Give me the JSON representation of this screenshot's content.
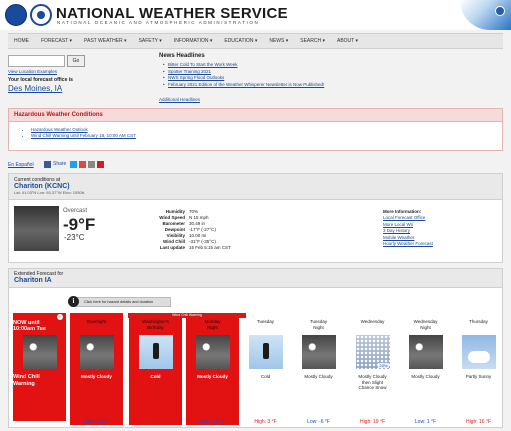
{
  "header": {
    "title": "NATIONAL WEATHER SERVICE",
    "subtitle": "NATIONAL OCEANIC AND ATMOSPHERIC ADMINISTRATION"
  },
  "nav": [
    "HOME",
    "FORECAST ▾",
    "PAST WEATHER ▾",
    "SAFETY ▾",
    "INFORMATION ▾",
    "EDUCATION ▾",
    "NEWS ▾",
    "SEARCH ▾",
    "ABOUT ▾"
  ],
  "location": {
    "input_value": "",
    "go_label": "Go",
    "view_examples": "View Location Examples",
    "office_label": "Your local forecast office is",
    "office_city": "Des Moines, IA"
  },
  "news": {
    "title": "News Headlines",
    "items": [
      "Bitter Cold To Start the Work Week",
      "Spotter Training 2021",
      "NWS Spring Flood Outlooks",
      "February 2021 Edition of the Weather Whisperer Newsletter is Now Published!"
    ],
    "additional": "Additional Headlines"
  },
  "hazardous": {
    "title": "Hazardous Weather Conditions",
    "items": [
      "Hazardous Weather Outlook",
      "Wind Chill Warning until February 18, 10:00 AM CST"
    ]
  },
  "espanol": "En Español",
  "share_label": "Share",
  "current": {
    "label": "Current conditions at",
    "station": "Chariton (KCNC)",
    "latlon": "Lat: 41.03°N  Lon: 93.37°W  Elev: 1050ft.",
    "summary": "Overcast",
    "temp_f": "-9°F",
    "temp_c": "-23°C",
    "rows": [
      {
        "key": "Humidity",
        "val": "70%"
      },
      {
        "key": "Wind Speed",
        "val": "N 15 mph"
      },
      {
        "key": "Barometer",
        "val": "30.49 in"
      },
      {
        "key": "Dewpoint",
        "val": "-17°F (-27°C)"
      },
      {
        "key": "Visibility",
        "val": "10.00 mi"
      },
      {
        "key": "Wind Chill",
        "val": "-31°F (-35°C)"
      },
      {
        "key": "Last update",
        "val": "15 Feb 5:15 am CST"
      }
    ],
    "more_info_title": "More Information:",
    "more_info_links": [
      "Local Forecast Office",
      "More Local Wx",
      "3 Day History",
      "Mobile Weather",
      "Hourly Weather Forecast"
    ]
  },
  "forecast": {
    "label": "Extended Forecast for",
    "location": "Chariton IA",
    "hazard_bar": "Click here for hazard details and duration",
    "wind_chill_band": "Wind Chill Warning",
    "now": {
      "name": "NOW until\n10:00am Tue",
      "desc": "Wind Chill\nWarning"
    },
    "periods": [
      {
        "name": "Overnight",
        "desc": "Mostly Cloudy",
        "temp": "Low: -12 °F",
        "kind": "low",
        "icon": "cloudy",
        "red": true
      },
      {
        "name": "Washington's\nBirthday",
        "desc": "Cold",
        "temp": "High: -2 °F",
        "kind": "high",
        "icon": "cold",
        "red": true
      },
      {
        "name": "Monday\nNight",
        "desc": "Mostly Cloudy",
        "temp": "Low: -15 °F",
        "kind": "low",
        "icon": "cloudy",
        "red": true
      },
      {
        "name": "Tuesday",
        "desc": "Cold",
        "temp": "High: 3 °F",
        "kind": "high",
        "icon": "cold",
        "red": false
      },
      {
        "name": "Tuesday\nNight",
        "desc": "Mostly Cloudy",
        "temp": "Low: -6 °F",
        "kind": "low",
        "icon": "cloudy",
        "red": false
      },
      {
        "name": "Wednesday",
        "desc": "Mostly Cloudy\nthen Slight\nChance Snow",
        "temp": "High: 19 °F",
        "kind": "high",
        "icon": "snow",
        "pct": "20%",
        "red": false
      },
      {
        "name": "Wednesday\nNight",
        "desc": "Mostly Cloudy",
        "temp": "Low: 1 °F",
        "kind": "low",
        "icon": "cloudy",
        "red": false
      },
      {
        "name": "Thursday",
        "desc": "Partly Sunny",
        "temp": "High: 16 °F",
        "kind": "high",
        "icon": "sunny",
        "red": false
      }
    ]
  }
}
